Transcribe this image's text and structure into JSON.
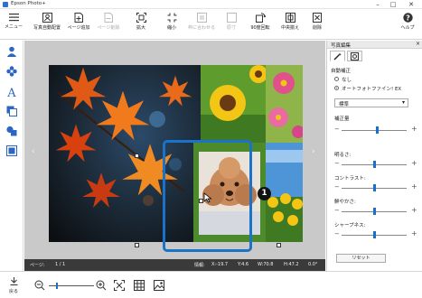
{
  "window": {
    "title": "Epson Photo+",
    "minimize_glyph": "–",
    "maximize_glyph": "□",
    "close_glyph": "✕"
  },
  "toolbar": {
    "menu": "メニュー",
    "file": "ファイル",
    "auto_layout": "写真自動配置",
    "add_page": "ページ追加",
    "delete_page": "ページ削除",
    "zoom_in": "拡大",
    "zoom_out": "縮小",
    "fit": "枠に合わせる",
    "size": "原寸",
    "rotate": "90度回転",
    "center": "中央揃え",
    "delete": "削除",
    "help": "ヘルプ"
  },
  "status": {
    "page_label": "ページ:",
    "page_value": "1 / 1",
    "info_label": "情報:",
    "x": "X:-19.7",
    "y": "Y:4.6",
    "w": "W:70.8",
    "h": "H:47.2",
    "angle": "0.0°"
  },
  "bottombar": {
    "back": "戻る"
  },
  "panel": {
    "title": "写真編集",
    "section": "自動補正",
    "option_none": "なし",
    "option_auto": "オートフォトファイン! EX",
    "dropdown_value": "標準",
    "correction_label": "補正量",
    "brightness_label": "明るさ:",
    "contrast_label": "コントラスト:",
    "saturation_label": "鮮やかさ:",
    "sharpness_label": "シャープネス:",
    "reset": "リセット",
    "slider_plus": "+",
    "slider_minus": "−",
    "sliders": {
      "correction": 0.55,
      "brightness": 0.5,
      "contrast": 0.5,
      "saturation": 0.5,
      "sharpness": 0.5
    },
    "auto_selected": true
  },
  "callout": "1",
  "colors": {
    "accent": "#1a73c9",
    "status_bar": "#3a3a3a",
    "canvas": "#c9c9c9"
  }
}
